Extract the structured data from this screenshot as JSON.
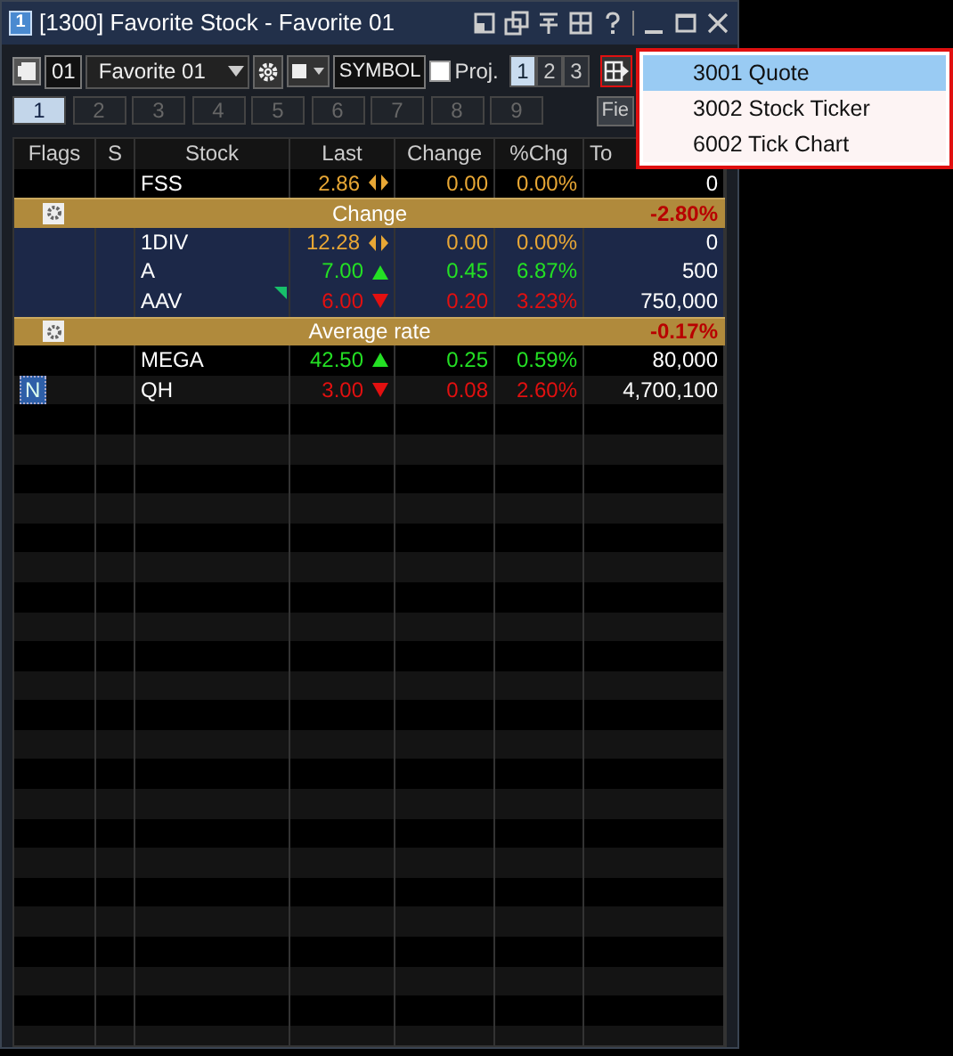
{
  "window": {
    "title": "[1300] Favorite Stock - Favorite 01",
    "badge": "1"
  },
  "toolbar": {
    "code": "01",
    "list": "Favorite 01",
    "symbol": "SYMBOL",
    "proj": {
      "label": "Proj.",
      "checked": false
    },
    "sets": [
      {
        "label": "1",
        "selected": true
      },
      {
        "label": "2",
        "selected": false
      },
      {
        "label": "3",
        "selected": false
      }
    ]
  },
  "pages": [
    {
      "label": "1",
      "selected": true
    },
    {
      "label": "2",
      "selected": false
    },
    {
      "label": "3",
      "selected": false
    },
    {
      "label": "4",
      "selected": false
    },
    {
      "label": "5",
      "selected": false
    },
    {
      "label": "6",
      "selected": false
    },
    {
      "label": "7",
      "selected": false
    },
    {
      "label": "8",
      "selected": false
    },
    {
      "label": "9",
      "selected": false
    }
  ],
  "field_button": "Fie",
  "table": {
    "columns": [
      "Flags",
      "S",
      "Stock",
      "Last",
      "Change",
      "%Chg",
      "To"
    ],
    "rows": [
      {
        "kind": "stock",
        "grouped": false,
        "flag": "",
        "stock": "FSS",
        "last": "2.86",
        "rising": false,
        "falling": false,
        "change": "0.00",
        "pct": "0.00%",
        "total": "0",
        "marked": false
      },
      {
        "kind": "group",
        "label": "Change",
        "pct": "-2.80%"
      },
      {
        "kind": "stock",
        "grouped": true,
        "flag": "",
        "stock": "1DIV",
        "last": "12.28",
        "rising": false,
        "falling": false,
        "change": "0.00",
        "pct": "0.00%",
        "total": "0",
        "marked": false
      },
      {
        "kind": "stock",
        "grouped": true,
        "flag": "",
        "stock": "A",
        "last": "7.00",
        "rising": true,
        "falling": false,
        "change": "0.45",
        "pct": "6.87%",
        "total": "500",
        "marked": false
      },
      {
        "kind": "stock",
        "grouped": true,
        "flag": "",
        "stock": "AAV",
        "last": "6.00",
        "rising": false,
        "falling": true,
        "change": "0.20",
        "pct": "3.23%",
        "total": "750,000",
        "marked": true
      },
      {
        "kind": "group",
        "label": "Average rate",
        "pct": "-0.17%"
      },
      {
        "kind": "stock",
        "grouped": false,
        "flag": "",
        "stock": "MEGA",
        "last": "42.50",
        "rising": true,
        "falling": false,
        "change": "0.25",
        "pct": "0.59%",
        "total": "80,000",
        "marked": false
      },
      {
        "kind": "stock",
        "grouped": false,
        "flag": "N",
        "stock": "QH",
        "last": "3.00",
        "rising": false,
        "falling": true,
        "change": "0.08",
        "pct": "2.60%",
        "total": "4,700,100",
        "marked": false
      }
    ]
  },
  "menu": [
    {
      "label": "3001 Quote",
      "selected": true
    },
    {
      "label": "3002 Stock Ticker",
      "selected": false
    },
    {
      "label": "6002 Tick Chart",
      "selected": false
    }
  ]
}
